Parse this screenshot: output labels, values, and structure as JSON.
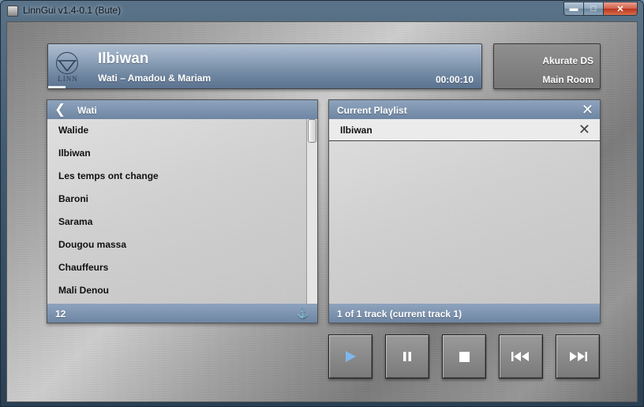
{
  "window": {
    "title": "LinnGui v1.4-0.1 (Bute)"
  },
  "now_playing": {
    "title": "Ilbiwan",
    "subtitle": "Wati – Amadou & Mariam",
    "time": "00:00:10",
    "logo_text": "LINN",
    "progress_fraction": 0.04
  },
  "device": {
    "name": "Akurate DS",
    "room": "Main Room"
  },
  "browser": {
    "title": "Wati",
    "count": "12",
    "tracks": [
      "Walide",
      "Ilbiwan",
      "Les temps ont change",
      "Baroni",
      "Sarama",
      "Dougou massa",
      "Chauffeurs",
      "Mali Denou"
    ]
  },
  "playlist": {
    "title": "Current Playlist",
    "tracks": [
      "Ilbiwan"
    ],
    "status": "1 of 1 track (current track 1)"
  },
  "icons": {
    "back": "chevron-left-icon",
    "close": "close-icon",
    "anchor": "anchor-icon",
    "play": "play-icon",
    "pause": "pause-icon",
    "stop": "stop-icon",
    "prev": "skip-previous-icon",
    "next": "skip-next-icon"
  },
  "colors": {
    "accent": "#7fb7ec",
    "header": "#6e86a3"
  }
}
